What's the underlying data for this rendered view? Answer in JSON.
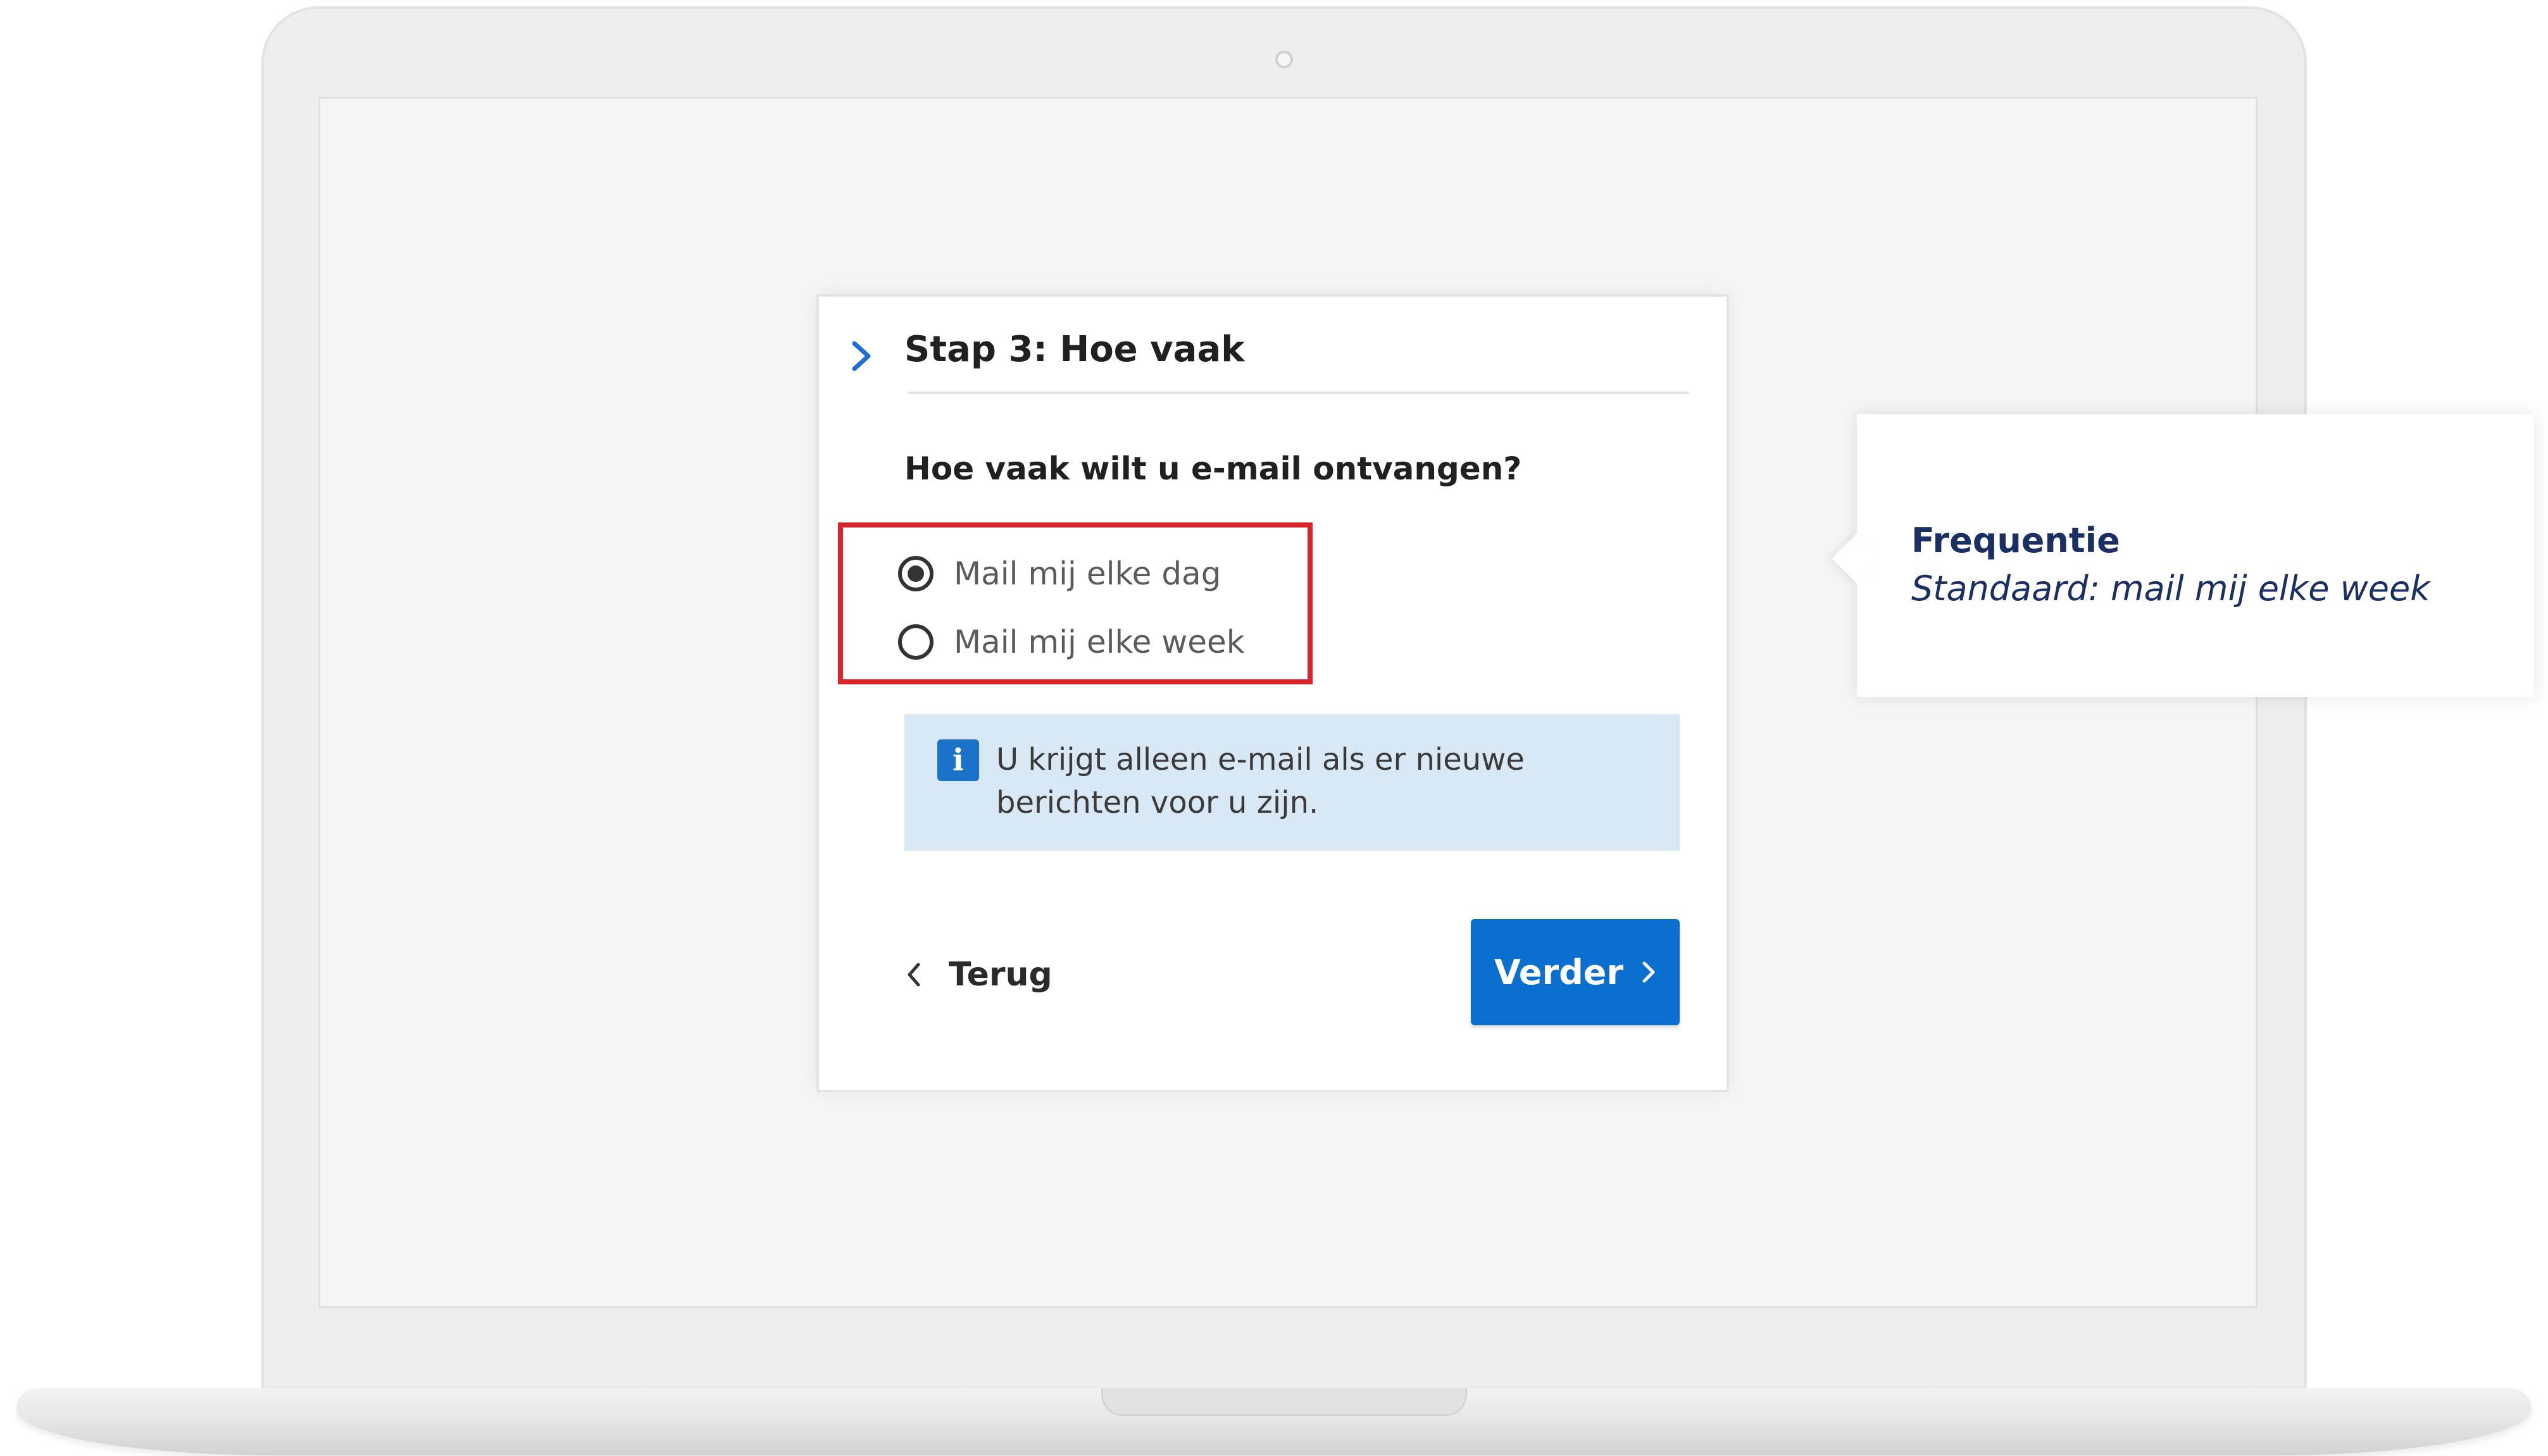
{
  "wizard": {
    "step_title": "Stap 3: Hoe vaak",
    "question": "Hoe vaak wilt u e-mail ontvangen?",
    "options": [
      {
        "label": "Mail mij elke dag",
        "selected": true
      },
      {
        "label": "Mail mij elke week",
        "selected": false
      }
    ],
    "info": {
      "icon": "info-icon",
      "line1": "U krijgt alleen e-mail als er nieuwe",
      "line2": "berichten voor u zijn."
    },
    "back_label": "Terug",
    "next_label": "Verder"
  },
  "annotation": {
    "title": "Frequentie",
    "subtitle": "Standaard: mail mij elke week",
    "highlight_color": "#d9262e"
  },
  "colors": {
    "primary_button": "#0a6fcf",
    "info_background": "#d9e8f5",
    "annotation_text": "#1b2f63"
  }
}
